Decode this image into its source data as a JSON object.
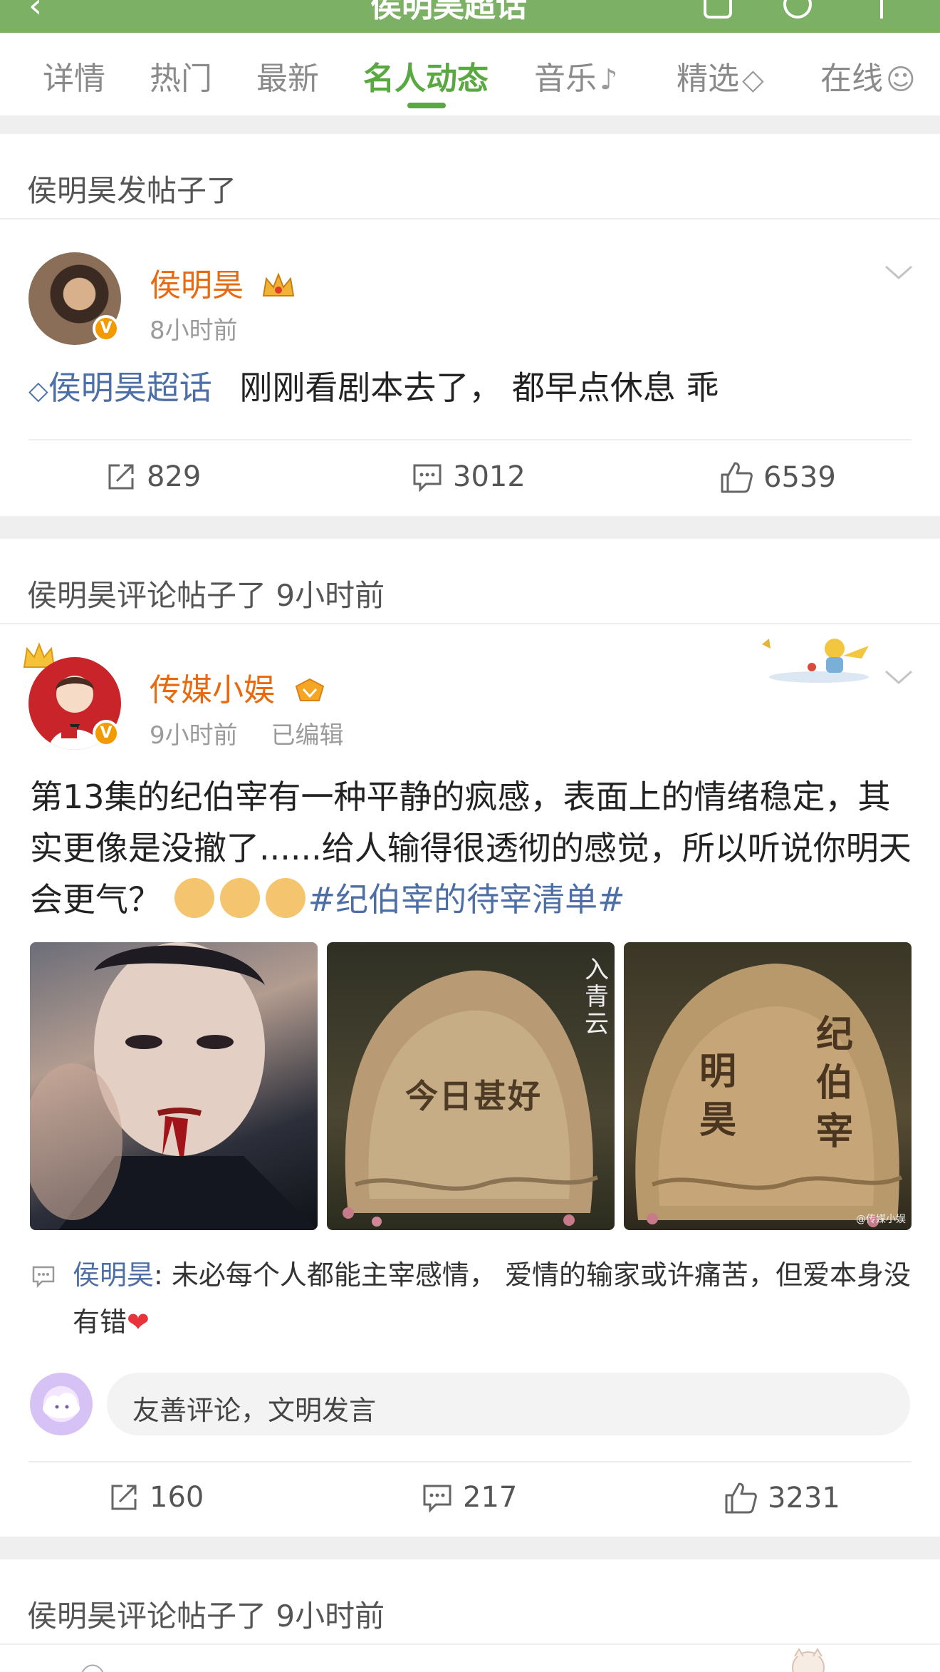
{
  "app_header": {
    "title": "侯明昊超话",
    "back_icon": "chevron-left-icon"
  },
  "tabs": [
    {
      "label": "详情",
      "active": false
    },
    {
      "label": "热门",
      "active": false
    },
    {
      "label": "最新",
      "active": false
    },
    {
      "label": "名人动态",
      "active": true
    },
    {
      "label": "音乐",
      "active": false,
      "icon": "music-note-icon"
    },
    {
      "label": "精选",
      "active": false,
      "icon": "gem-icon"
    },
    {
      "label": "在线",
      "active": false,
      "icon": "smiley-icon"
    }
  ],
  "feed": [
    {
      "header": "侯明昊发帖子了",
      "author": "侯明昊",
      "time": "8小时前",
      "topic": "侯明昊超话",
      "text": "刚刚看剧本去了，  都早点休息  乖",
      "stats": {
        "reposts": "829",
        "comments": "3012",
        "likes": "6539"
      }
    },
    {
      "header": "侯明昊评论帖子了 9小时前",
      "author": "传媒小娱",
      "time": "9小时前",
      "edited": "已编辑",
      "text": "第13集的纪伯宰有一种平静的疯感，表面上的情绪稳定，其实更像是没撤了......给人输得很透彻的感觉，所以听说你明天会更气？",
      "hashtag": "#纪伯宰的待宰清单#",
      "images": [
        {
          "caption": ""
        },
        {
          "caption": "今日甚好",
          "side_text": "入青云"
        },
        {
          "caption_left": "明昊",
          "caption_right": "纪伯宰",
          "watermark": "@传媒小娱"
        }
      ],
      "comment": {
        "author": "侯明昊",
        "text": "未必每个人都能主宰感情，  爱情的输家或许痛苦，但爱本身没有错"
      },
      "input_placeholder": "友善评论，文明发言",
      "stats": {
        "reposts": "160",
        "comments": "217",
        "likes": "3231"
      }
    },
    {
      "header": "侯明昊评论帖子了 9小时前"
    }
  ],
  "colors": {
    "brand_green": "#7cb064",
    "active_tab": "#5aa842",
    "username": "#e86a10",
    "link": "#4d6fa6",
    "verified_badge": "#f39a00"
  }
}
